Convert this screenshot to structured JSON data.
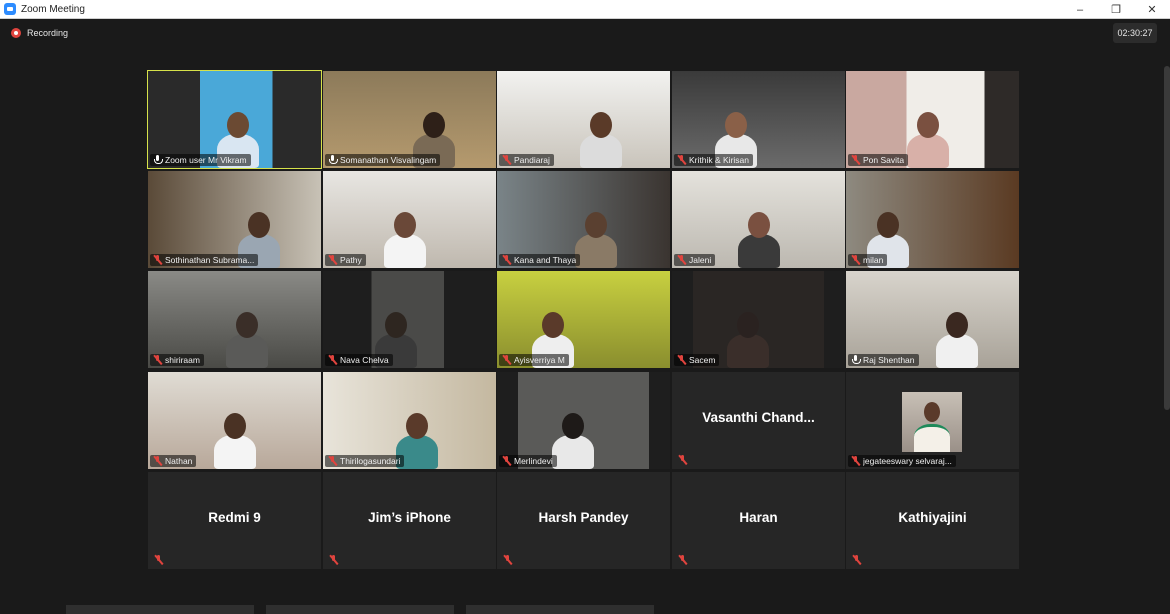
{
  "window": {
    "title": "Zoom Meeting",
    "controls": [
      "–",
      "❐",
      "✕"
    ]
  },
  "recording": {
    "label": "Recording"
  },
  "timer": {
    "value": "02:30:27"
  },
  "tiles": [
    {
      "name": "Zoom user Mr Vikram",
      "muted": false,
      "active": true,
      "video": true
    },
    {
      "name": "Somanathan Visvalingam",
      "muted": false,
      "video": true
    },
    {
      "name": "Pandiaraj",
      "muted": true,
      "video": true
    },
    {
      "name": "Krithik & Kirisan",
      "muted": true,
      "video": true
    },
    {
      "name": "Pon Savita",
      "muted": true,
      "video": true
    },
    {
      "name": "Sothinathan Subrama...",
      "muted": true,
      "video": true
    },
    {
      "name": "Pathy",
      "muted": true,
      "video": true
    },
    {
      "name": "Kana and Thaya",
      "muted": true,
      "video": true
    },
    {
      "name": "Jaleni",
      "muted": true,
      "video": true
    },
    {
      "name": "milan",
      "muted": true,
      "video": true
    },
    {
      "name": "shiriraam",
      "muted": true,
      "video": true
    },
    {
      "name": "Nava Chelva",
      "muted": true,
      "video": true
    },
    {
      "name": "Ayisverriya M",
      "muted": true,
      "video": true
    },
    {
      "name": "Sacem",
      "muted": true,
      "video": true
    },
    {
      "name": "Raj Shenthan",
      "muted": false,
      "video": true
    },
    {
      "name": "Nathan",
      "muted": true,
      "video": true
    },
    {
      "name": "Thirilogasundari",
      "muted": true,
      "video": true
    },
    {
      "name": "Merlindevi",
      "muted": true,
      "video": true
    },
    {
      "name": "Vasanthi  Chand...",
      "muted": true,
      "video": false
    },
    {
      "name": "jegateeswary selvaraj...",
      "muted": true,
      "video": "photo"
    },
    {
      "name": "Redmi 9",
      "muted": true,
      "video": false
    },
    {
      "name": "Jim’s iPhone",
      "muted": true,
      "video": false
    },
    {
      "name": "Harsh Pandey",
      "muted": true,
      "video": false
    },
    {
      "name": "Haran",
      "muted": true,
      "video": false
    },
    {
      "name": "Kathiyajini",
      "muted": true,
      "video": false
    }
  ],
  "colors": {
    "active_border": "#d6e24a",
    "muted_icon": "#e0443e",
    "background": "#1a1a1a",
    "tile": "#262626"
  }
}
